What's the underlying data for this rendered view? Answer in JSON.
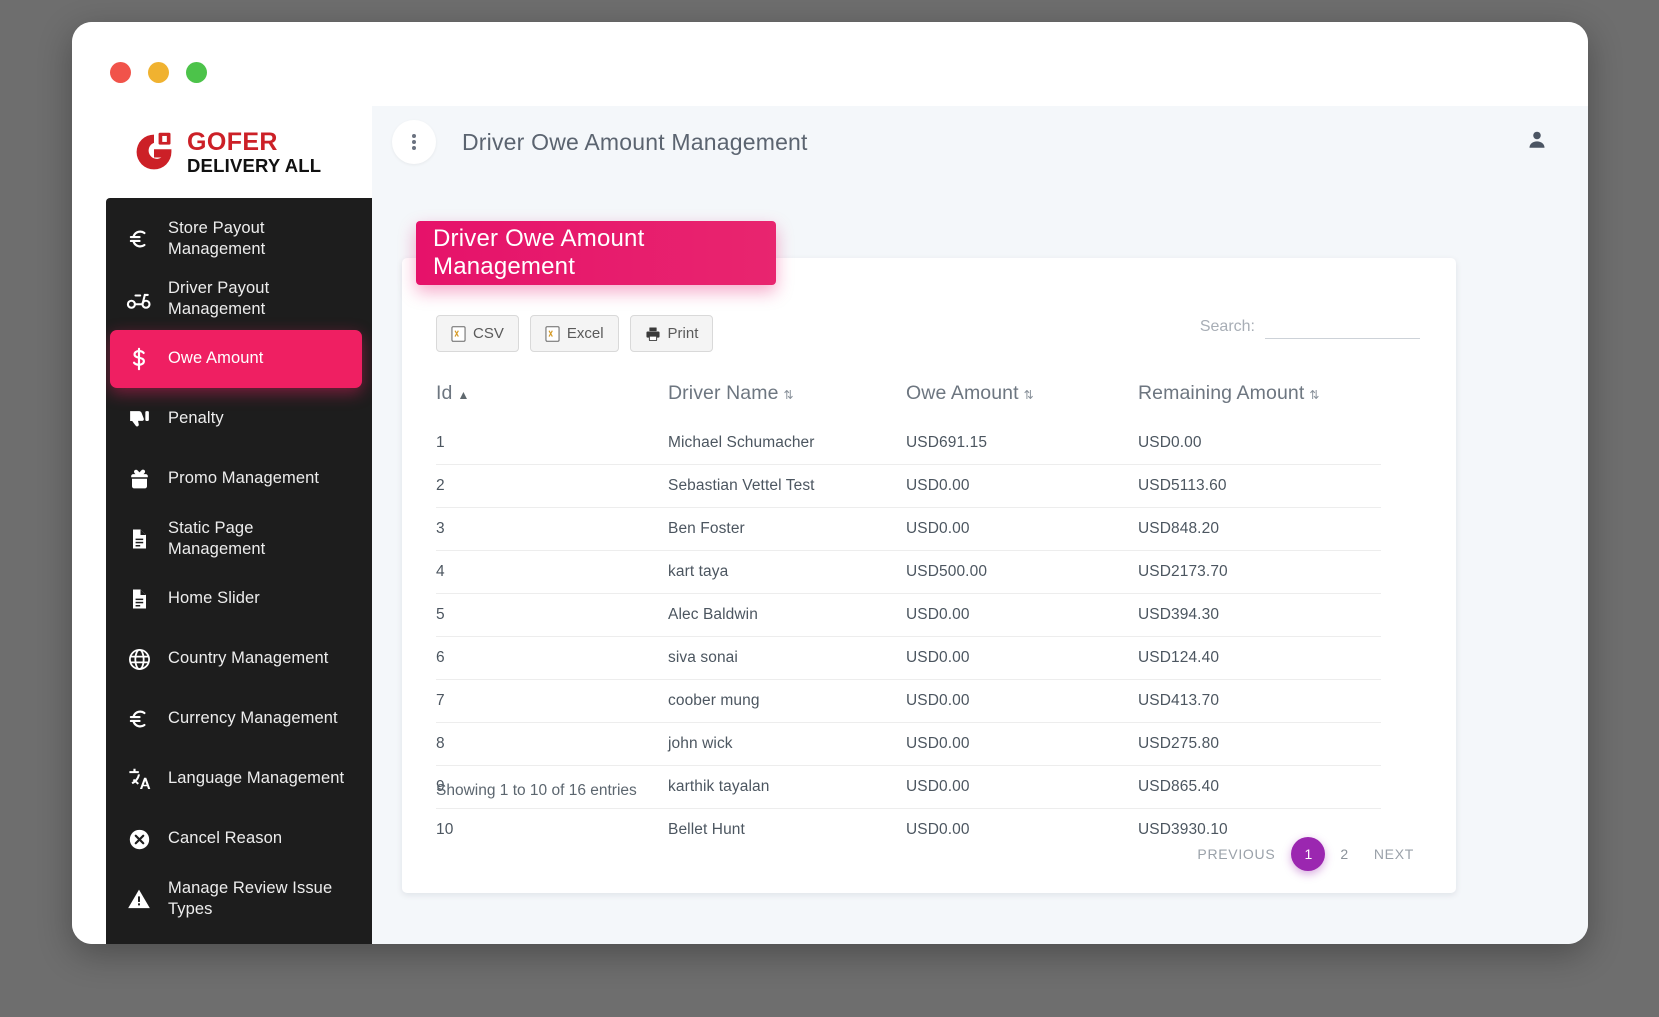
{
  "window": {
    "traffic_lights": [
      "close",
      "minimize",
      "maximize"
    ]
  },
  "brand": {
    "name_top": "GOFER",
    "name_bottom": "DELIVERY ALL",
    "logo_icon": "gofer-logo-icon",
    "color_primary": "#cc2027"
  },
  "sidebar": {
    "items": [
      {
        "label": "Store Payout Management",
        "icon": "euro-icon",
        "active": false
      },
      {
        "label": "Driver Payout Management",
        "icon": "scooter-icon",
        "active": false
      },
      {
        "label": "Owe Amount",
        "icon": "dollar-icon",
        "active": true
      },
      {
        "label": "Penalty",
        "icon": "thumbs-down-icon",
        "active": false
      },
      {
        "label": "Promo Management",
        "icon": "gift-icon",
        "active": false
      },
      {
        "label": "Static Page Management",
        "icon": "document-icon",
        "active": false
      },
      {
        "label": "Home Slider",
        "icon": "document-icon",
        "active": false
      },
      {
        "label": "Country Management",
        "icon": "globe-icon",
        "active": false
      },
      {
        "label": "Currency Management",
        "icon": "euro-icon",
        "active": false
      },
      {
        "label": "Language Management",
        "icon": "translate-icon",
        "active": false
      },
      {
        "label": "Cancel Reason",
        "icon": "x-circle-icon",
        "active": false
      },
      {
        "label": "Manage Review Issue Types",
        "icon": "warning-triangle-icon",
        "active": false
      }
    ],
    "active_color": "#ef1f62",
    "background": "#1d1d1d"
  },
  "topbar": {
    "menu_icon": "kebab-menu-icon",
    "title": "Driver Owe Amount Management",
    "user_icon": "user-icon"
  },
  "card": {
    "banner_title": "Driver Owe Amount Management",
    "banner_color": "#e6126a",
    "toolbar": [
      {
        "label": "CSV",
        "icon": "csv-file-icon"
      },
      {
        "label": "Excel",
        "icon": "excel-file-icon"
      },
      {
        "label": "Print",
        "icon": "printer-icon"
      }
    ],
    "search": {
      "label": "Search:",
      "value": "",
      "placeholder": ""
    },
    "table": {
      "columns": [
        {
          "label": "Id",
          "sort": "asc"
        },
        {
          "label": "Driver Name",
          "sort": "none"
        },
        {
          "label": "Owe Amount",
          "sort": "none"
        },
        {
          "label": "Remaining Amount",
          "sort": "none"
        }
      ],
      "rows": [
        {
          "id": "1",
          "driver_name": "Michael Schumacher",
          "owe_amount": "USD691.15",
          "remaining_amount": "USD0.00"
        },
        {
          "id": "2",
          "driver_name": "Sebastian Vettel Test",
          "owe_amount": "USD0.00",
          "remaining_amount": "USD5113.60"
        },
        {
          "id": "3",
          "driver_name": "Ben Foster",
          "owe_amount": "USD0.00",
          "remaining_amount": "USD848.20"
        },
        {
          "id": "4",
          "driver_name": "kart taya",
          "owe_amount": "USD500.00",
          "remaining_amount": "USD2173.70"
        },
        {
          "id": "5",
          "driver_name": "Alec Baldwin",
          "owe_amount": "USD0.00",
          "remaining_amount": "USD394.30"
        },
        {
          "id": "6",
          "driver_name": "siva sonai",
          "owe_amount": "USD0.00",
          "remaining_amount": "USD124.40"
        },
        {
          "id": "7",
          "driver_name": "coober mung",
          "owe_amount": "USD0.00",
          "remaining_amount": "USD413.70"
        },
        {
          "id": "8",
          "driver_name": "john wick",
          "owe_amount": "USD0.00",
          "remaining_amount": "USD275.80"
        },
        {
          "id": "9",
          "driver_name": "karthik tayalan",
          "owe_amount": "USD0.00",
          "remaining_amount": "USD865.40"
        },
        {
          "id": "10",
          "driver_name": "Bellet Hunt",
          "owe_amount": "USD0.00",
          "remaining_amount": "USD3930.10"
        }
      ]
    },
    "showing_text": "Showing 1 to 10 of 16 entries",
    "pagination": {
      "previous_label": "PREVIOUS",
      "next_label": "NEXT",
      "pages": [
        "1",
        "2"
      ],
      "active_page": "1",
      "active_color": "#9b27b0"
    }
  }
}
